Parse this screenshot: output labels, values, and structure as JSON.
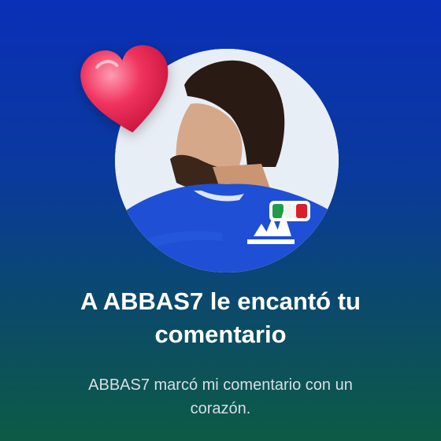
{
  "notification": {
    "title": "A ABBAS7 le encantó tu\ncomentario",
    "subtitle": "ABBAS7 marcó mi comentario con un\ncorazón."
  },
  "icons": {
    "reaction": "heart-icon",
    "profile": "avatar"
  },
  "colors": {
    "heart": "#ef2a55",
    "jersey": "#1f4fd4",
    "background_top": "#0a2fb8",
    "background_bottom": "#0d5b45"
  }
}
